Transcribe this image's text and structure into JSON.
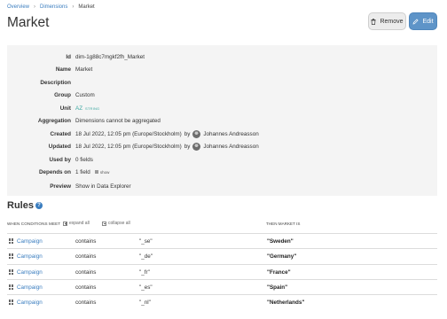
{
  "breadcrumb": {
    "items": [
      "Overview",
      "Dimensions"
    ],
    "current": "Market"
  },
  "page_title": "Market",
  "actions": {
    "remove_label": "Remove",
    "edit_label": "Edit"
  },
  "details": {
    "id": {
      "label": "Id",
      "value": "dim-1g88c7mgkf2fh_Market"
    },
    "name": {
      "label": "Name",
      "value": "Market"
    },
    "description": {
      "label": "Description",
      "value": ""
    },
    "group": {
      "label": "Group",
      "value": "Custom"
    },
    "unit": {
      "label": "Unit",
      "value": "AZ",
      "tag": "STRING"
    },
    "aggregation": {
      "label": "Aggregation",
      "value": "Dimensions cannot be aggregated"
    },
    "created": {
      "label": "Created",
      "date": "18 Jul 2022, 12:05 pm (Europe/Stockholm)",
      "by": "by",
      "user": "Johannes Andreasson"
    },
    "updated": {
      "label": "Updated",
      "date": "18 Jul 2022, 12:05 pm (Europe/Stockholm)",
      "by": "by",
      "user": "Johannes Andreasson"
    },
    "used_by": {
      "label": "Used by",
      "value": "0 fields"
    },
    "depends_on": {
      "label": "Depends on",
      "value": "1 field",
      "show_label": "show"
    },
    "preview": {
      "label": "Preview",
      "link": "Show in Data Explorer"
    }
  },
  "rules": {
    "title": "Rules",
    "help_icon": "?",
    "header": {
      "when": "WHEN CONDITIONS MEET",
      "expand_all": "expand all",
      "collapse_all": "collapse all",
      "then": "THEN MARKET IS"
    },
    "rows": [
      {
        "dimension": "Campaign",
        "operator": "contains",
        "value": "\"_se\"",
        "result": "\"Sweden\""
      },
      {
        "dimension": "Campaign",
        "operator": "contains",
        "value": "\"_de\"",
        "result": "\"Germany\""
      },
      {
        "dimension": "Campaign",
        "operator": "contains",
        "value": "\"_fr\"",
        "result": "\"France\""
      },
      {
        "dimension": "Campaign",
        "operator": "contains",
        "value": "\"_es\"",
        "result": "\"Spain\""
      },
      {
        "dimension": "Campaign",
        "operator": "contains",
        "value": "\"_nl\"",
        "result": "\"Netherlands\""
      }
    ]
  },
  "colors": {
    "link": "#3a7dbf",
    "edit_button": "#5e94c8",
    "unit": "#3aa7a0",
    "panel": "#f4f4f4"
  },
  "icons": {
    "remove": "trash-icon",
    "edit": "pencil-icon",
    "help": "help-icon",
    "dimension": "dimension-grid-icon",
    "expand": "expand-all-icon",
    "collapse": "collapse-all-icon"
  }
}
